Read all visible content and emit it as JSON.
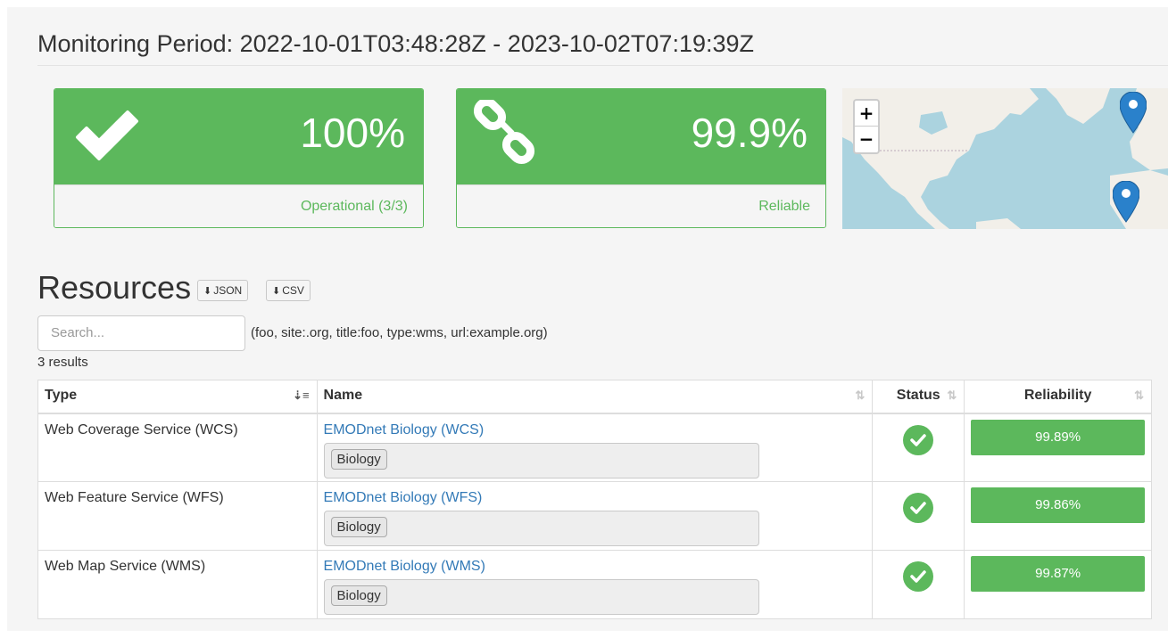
{
  "header": {
    "monitoring_period": "Monitoring Period: 2022-10-01T03:48:28Z - 2023-10-02T07:19:39Z"
  },
  "panels": [
    {
      "icon": "check-icon",
      "value": "100%",
      "label": "Operational (3/3)"
    },
    {
      "icon": "link-icon",
      "value": "99.9%",
      "label": "Reliable"
    }
  ],
  "map": {
    "zoom_in": "+",
    "zoom_out": "−",
    "markers": [
      "map-marker-icon",
      "map-marker-icon"
    ]
  },
  "resources": {
    "title": "Resources",
    "json_button": "JSON",
    "csv_button": "CSV",
    "search_placeholder": "Search...",
    "search_hint": "(foo, site:.org, title:foo, type:wms, url:example.org)",
    "results_count": "3 results",
    "columns": [
      "Type",
      "Name",
      "Status",
      "Reliability"
    ],
    "rows": [
      {
        "type": "Web Coverage Service (WCS)",
        "name": "EMODnet Biology (WCS)",
        "tag": "Biology",
        "status": "ok",
        "reliability": "99.89%"
      },
      {
        "type": "Web Feature Service (WFS)",
        "name": "EMODnet Biology (WFS)",
        "tag": "Biology",
        "status": "ok",
        "reliability": "99.86%"
      },
      {
        "type": "Web Map Service (WMS)",
        "name": "EMODnet Biology (WMS)",
        "tag": "Biology",
        "status": "ok",
        "reliability": "99.87%"
      }
    ]
  },
  "colors": {
    "success": "#5cb85c",
    "link": "#337ab7",
    "map_water": "#abd3df",
    "map_marker": "#2a81cb"
  }
}
